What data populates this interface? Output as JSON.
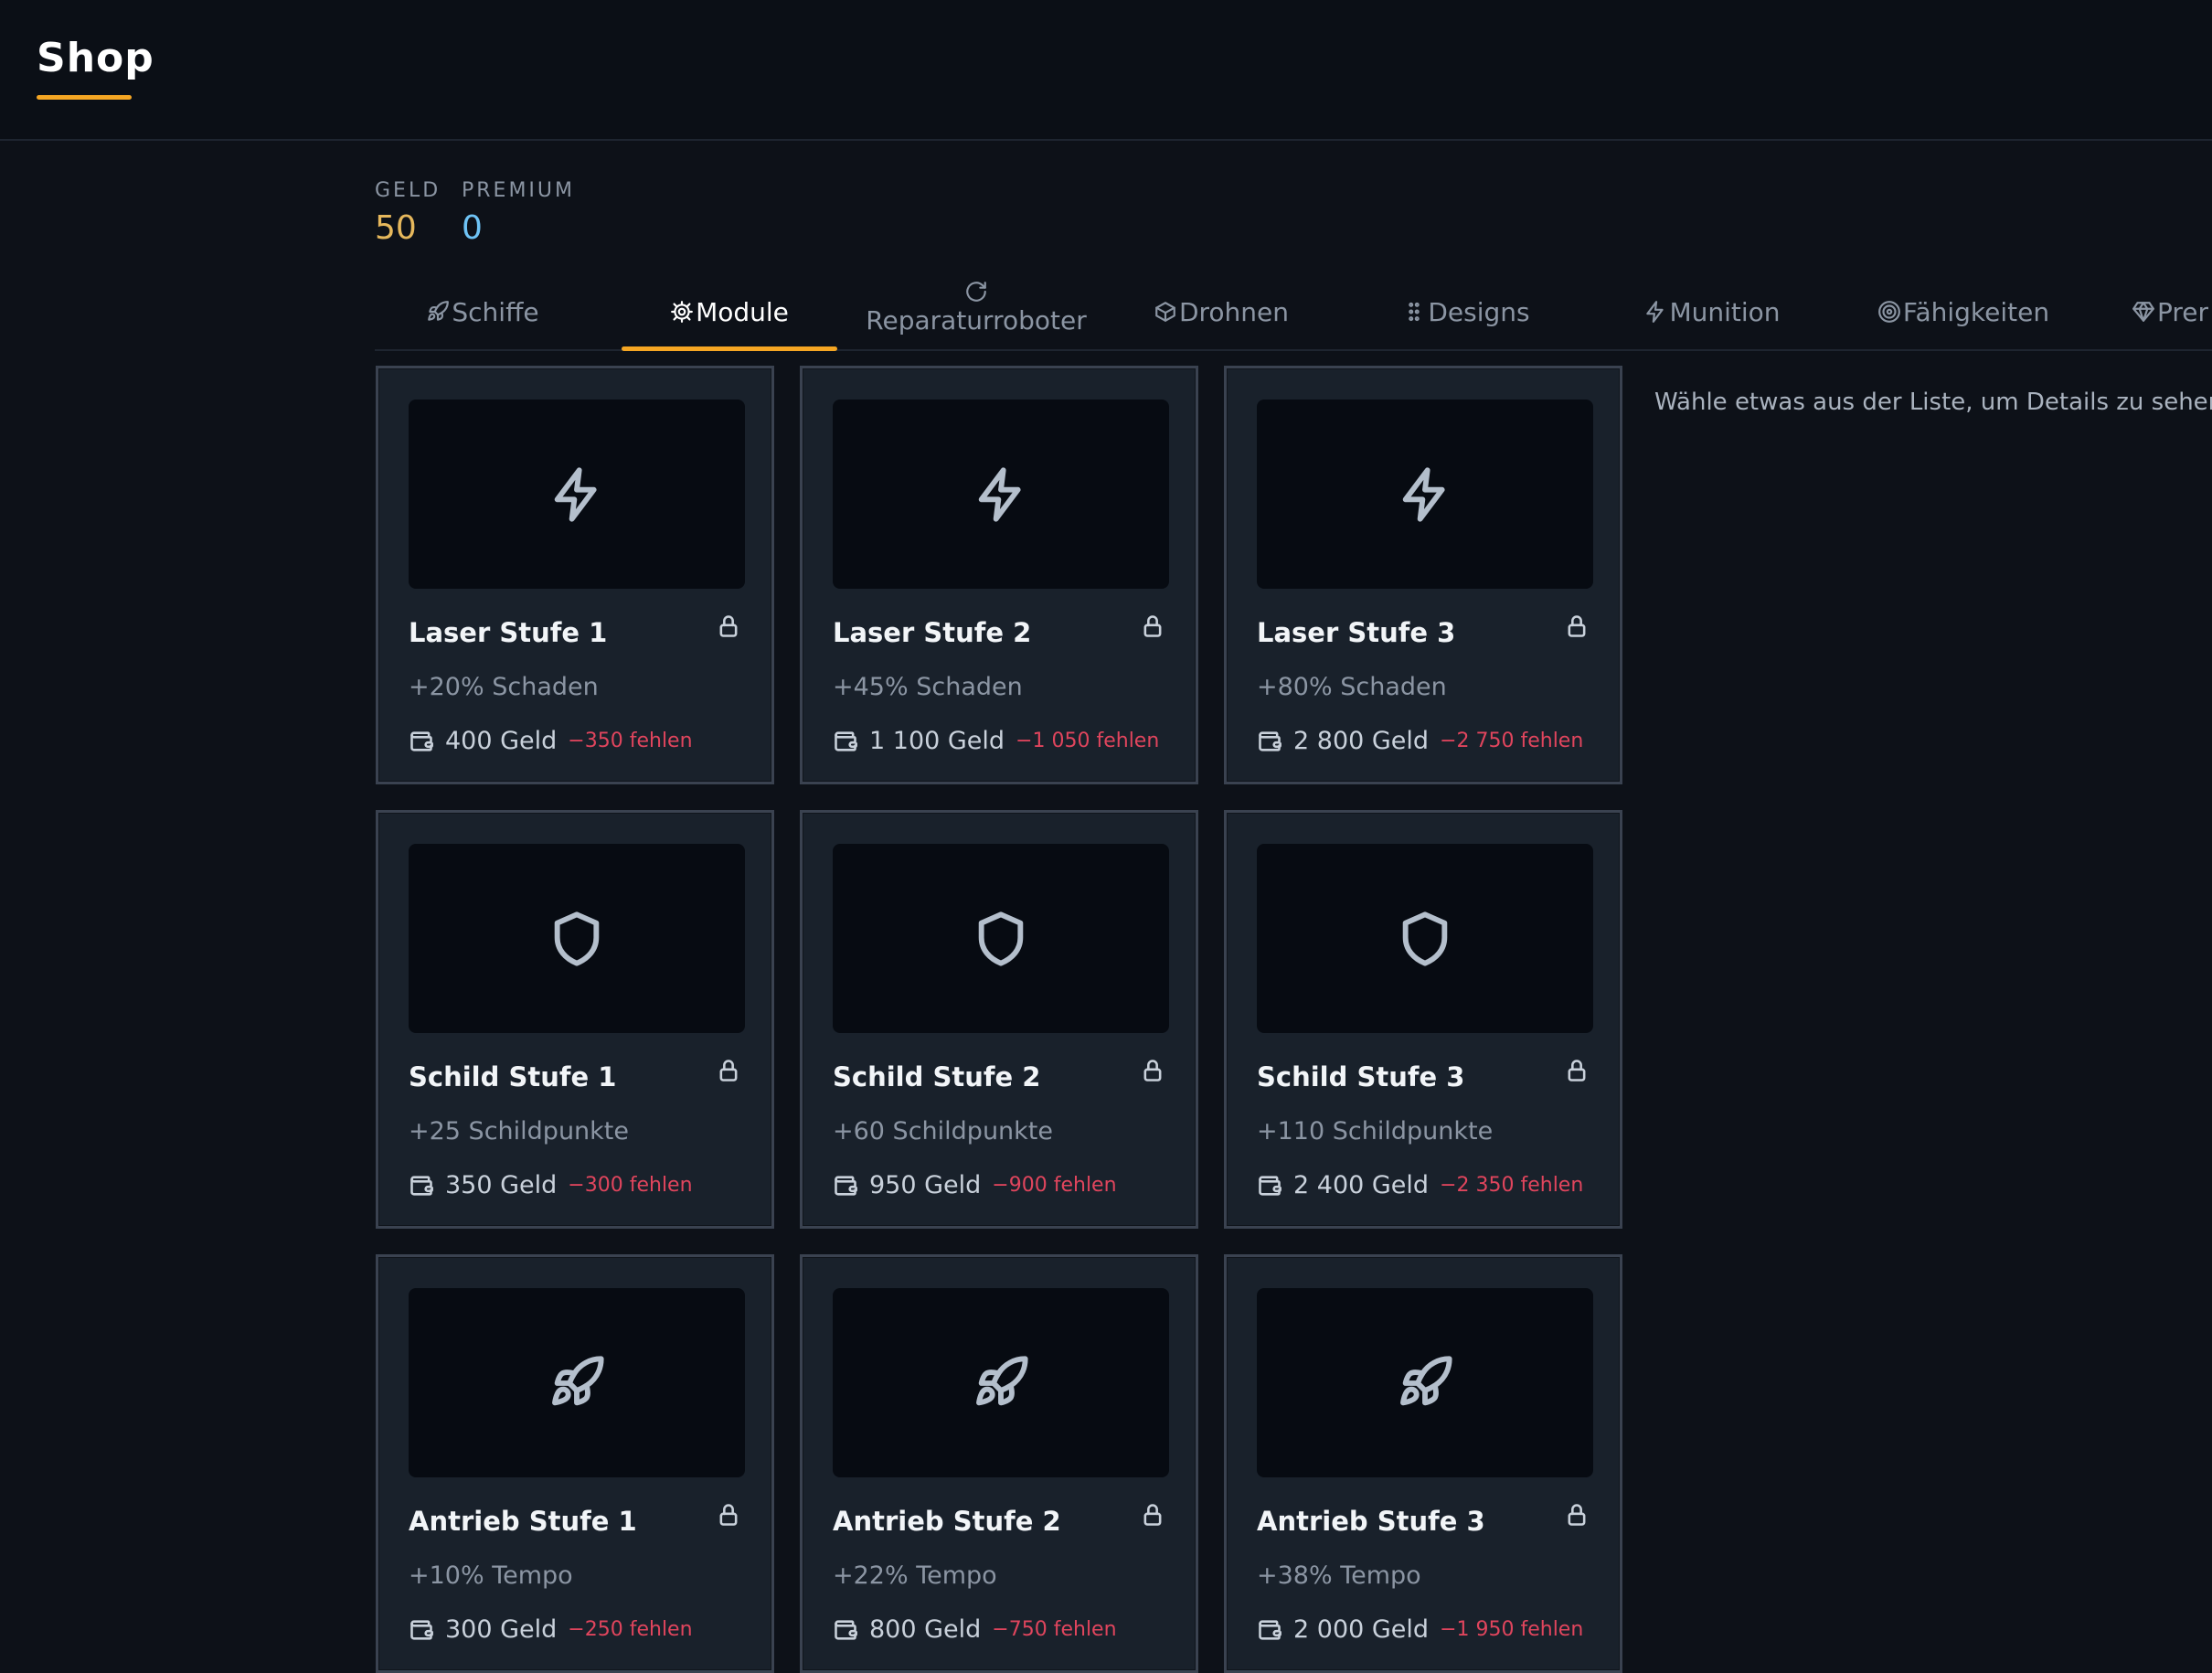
{
  "header": {
    "title": "Shop"
  },
  "wallet": {
    "geld_label": "GELD",
    "geld_value": "50",
    "premium_label": "PREMIUM",
    "premium_value": "0"
  },
  "tabs": [
    {
      "label": "Schiffe",
      "icon": "rocket-icon"
    },
    {
      "label": "Module",
      "icon": "gear-icon",
      "active": true
    },
    {
      "label": "Reparaturroboter",
      "icon": "refresh-icon"
    },
    {
      "label": "Drohnen",
      "icon": "box-icon"
    },
    {
      "label": "Designs",
      "icon": "dots-icon"
    },
    {
      "label": "Munition",
      "icon": "bolt-icon"
    },
    {
      "label": "Fähigkeiten",
      "icon": "target-icon"
    },
    {
      "label": "Prer",
      "icon": "diamond-icon"
    }
  ],
  "items": [
    {
      "name": "Laser Stufe 1",
      "desc": "+20% Schaden",
      "price": "400 Geld",
      "missing": "−350 fehlen",
      "icon": "bolt-icon"
    },
    {
      "name": "Laser Stufe 2",
      "desc": "+45% Schaden",
      "price": "1 100 Geld",
      "missing": "−1 050 fehlen",
      "icon": "bolt-icon"
    },
    {
      "name": "Laser Stufe 3",
      "desc": "+80% Schaden",
      "price": "2 800 Geld",
      "missing": "−2 750 fehlen",
      "icon": "bolt-icon"
    },
    {
      "name": "Schild Stufe 1",
      "desc": "+25 Schildpunkte",
      "price": "350 Geld",
      "missing": "−300 fehlen",
      "icon": "shield-icon"
    },
    {
      "name": "Schild Stufe 2",
      "desc": "+60 Schildpunkte",
      "price": "950 Geld",
      "missing": "−900 fehlen",
      "icon": "shield-icon"
    },
    {
      "name": "Schild Stufe 3",
      "desc": "+110 Schildpunkte",
      "price": "2 400 Geld",
      "missing": "−2 350 fehlen",
      "icon": "shield-icon"
    },
    {
      "name": "Antrieb Stufe 1",
      "desc": "+10% Tempo",
      "price": "300 Geld",
      "missing": "−250 fehlen",
      "icon": "rocket-icon"
    },
    {
      "name": "Antrieb Stufe 2",
      "desc": "+22% Tempo",
      "price": "800 Geld",
      "missing": "−750 fehlen",
      "icon": "rocket-icon"
    },
    {
      "name": "Antrieb Stufe 3",
      "desc": "+38% Tempo",
      "price": "2 000 Geld",
      "missing": "−1 950 fehlen",
      "icon": "rocket-icon"
    }
  ],
  "details": {
    "hint": "Wähle etwas aus der Liste, um Details zu sehen."
  },
  "colors": {
    "accent": "#f5a623",
    "geld": "#e6b85c",
    "premium": "#6ec3f5",
    "missing": "#e0455d"
  }
}
